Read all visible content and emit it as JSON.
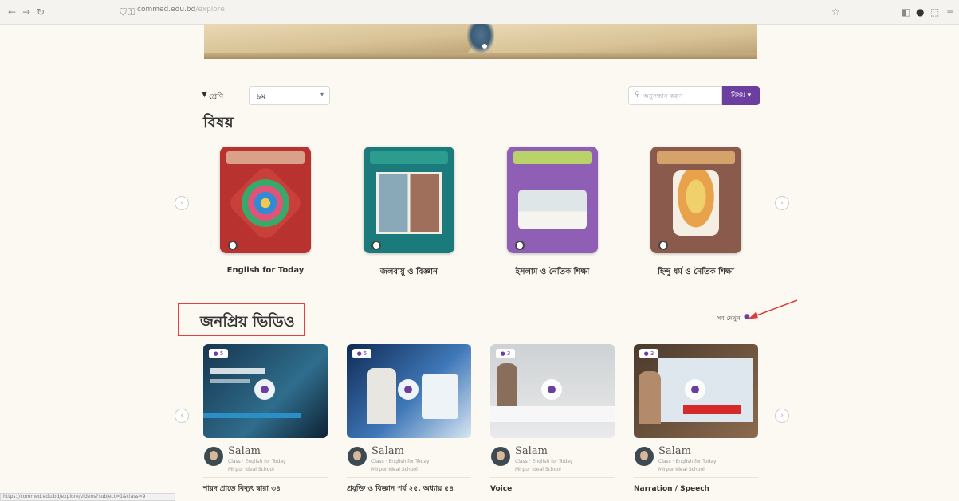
{
  "browser": {
    "back_icon": "arrow-left-icon",
    "forward_icon": "arrow-right-icon",
    "reload_icon": "reload-icon",
    "url_host": "commed.edu.bd",
    "url_path": "/explore"
  },
  "filters": {
    "class_label": "শ্রেণি",
    "class_value": "৯ম",
    "search_placeholder": "অনুসন্ধান করুন",
    "subject_button": "বিষয়"
  },
  "subjects": {
    "heading": "বিষয়",
    "books": [
      {
        "title": "English for Today",
        "cover_color": "#b8322f"
      },
      {
        "title": "জলবায়ু ও বিজ্ঞান",
        "cover_color": "#1b7a7c"
      },
      {
        "title": "ইসলাম ও নৈতিক শিক্ষা",
        "cover_color": "#8e5fb4"
      },
      {
        "title": "হিন্দু ধর্ম ও নৈতিক শিক্ষা",
        "cover_color": "#8a5a4c"
      }
    ]
  },
  "popular": {
    "heading": "জনপ্রিয় ভিডিও",
    "see_all": "সব দেখুন",
    "videos": [
      {
        "views": "● 5",
        "author": "Salam",
        "meta1": "Class · English for Today",
        "meta2": "Mirpur Ideal School",
        "title": "শারদ প্রাতে বিদ্যুৎ দ্বারা ৩৪"
      },
      {
        "views": "● 5",
        "author": "Salam",
        "meta1": "Class · English for Today",
        "meta2": "Mirpur Ideal School",
        "title": "প্রযুক্তি ও বিজ্ঞান পর্ব ২৫, অধ্যায় ৫৪"
      },
      {
        "views": "● 3",
        "author": "Salam",
        "meta1": "Class · English for Today",
        "meta2": "Mirpur Ideal School",
        "title": "Voice"
      },
      {
        "views": "● 3",
        "author": "Salam",
        "meta1": "Class · English for Today",
        "meta2": "Mirpur Ideal School",
        "title": "Narration / Speech"
      }
    ]
  },
  "status_bar_text": "https://commed.edu.bd/explore/videos?subject=1&class=9"
}
